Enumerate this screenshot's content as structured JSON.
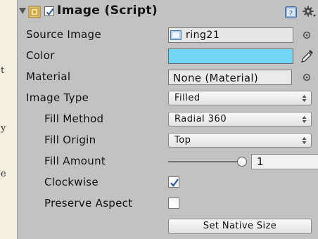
{
  "edge_text": [
    "t",
    "y",
    "e"
  ],
  "component": {
    "title": "Image (Script)",
    "enabled": true,
    "icons": [
      "foldout-arrow-icon",
      "image-component-icon",
      "help-icon",
      "gear-icon"
    ]
  },
  "fields": {
    "source_image": {
      "label": "Source Image",
      "value": "ring21"
    },
    "color": {
      "label": "Color",
      "value": "#70d4f2"
    },
    "material": {
      "label": "Material",
      "value": "None (Material)"
    },
    "image_type": {
      "label": "Image Type",
      "value": "Filled"
    },
    "fill_method": {
      "label": "Fill Method",
      "value": "Radial 360"
    },
    "fill_origin": {
      "label": "Fill Origin",
      "value": "Top"
    },
    "fill_amount": {
      "label": "Fill Amount",
      "value": "1",
      "slider_fraction": 1
    },
    "clockwise": {
      "label": "Clockwise",
      "checked": true
    },
    "preserve_aspect": {
      "label": "Preserve Aspect",
      "checked": false
    }
  },
  "buttons": {
    "set_native_size": "Set Native Size"
  },
  "colors": {
    "panel_bg": "#c2c2c2",
    "page_bg": "#f2eee0",
    "checkmark": "#3b5f9c"
  }
}
